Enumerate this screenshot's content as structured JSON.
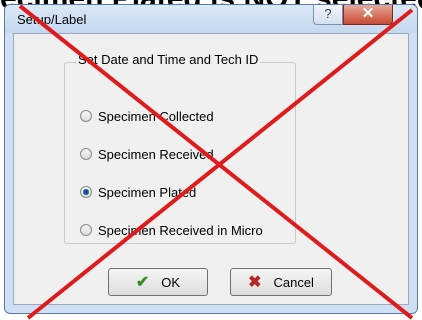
{
  "banner": {
    "text": "ecimen Plated is NOT selected"
  },
  "window": {
    "title": "Setup/Label",
    "help_label": "?",
    "close_label": "✕"
  },
  "group": {
    "legend": "Set Date and Time and Tech ID",
    "options": [
      {
        "label": "Specimen Collected",
        "checked": false
      },
      {
        "label": "Specimen Received",
        "checked": false
      },
      {
        "label": "Specimen Plated",
        "checked": true
      },
      {
        "label": "Specimen Received in Micro",
        "checked": false
      }
    ]
  },
  "buttons": {
    "ok_label": "OK",
    "ok_icon": "checkmark-icon",
    "cancel_label": "Cancel",
    "cancel_icon": "x-cancel-icon"
  },
  "overlay": {
    "cross_color": "#e01b1b"
  }
}
